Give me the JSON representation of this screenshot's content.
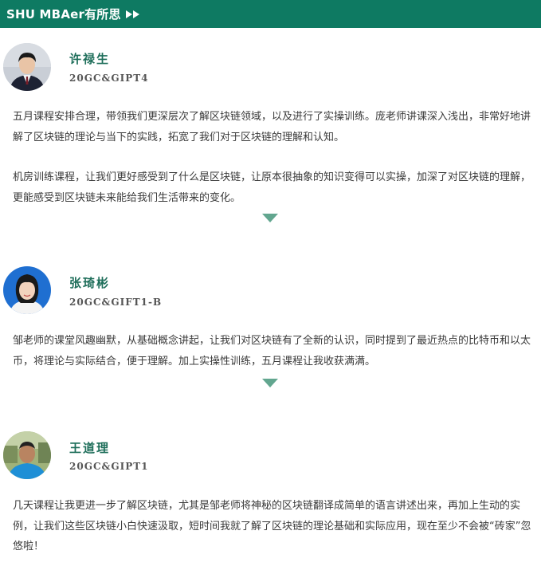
{
  "header": {
    "title": "SHU MBAer有所思",
    "arrow_icon": "double-play-icon",
    "background": "#0e7a62"
  },
  "profiles": [
    {
      "name": "许禄生",
      "class": "20GC&GIPT4",
      "avatar": "avatar-man-suit-photo",
      "paragraphs": [
        "五月课程安排合理，带领我们更深层次了解区块链领域，以及进行了实操训练。庞老师讲课深入浅出，非常好地讲解了区块链的理论与当下的实践，拓宽了我们对于区块链的理解和认知。",
        "机房训练课程，让我们更好感受到了什么是区块链，让原本很抽象的知识变得可以实操，加深了对区块链的理解，更能感受到区块链未来能给我们生活带来的变化。"
      ]
    },
    {
      "name": "张琦彬",
      "class": "20GC&GIFT1-B",
      "avatar": "avatar-woman-blue-background-photo",
      "paragraphs": [
        "邹老师的课堂风趣幽默，从基础概念讲起，让我们对区块链有了全新的认识，同时提到了最近热点的比特币和以太币，将理论与实际结合，便于理解。加上实操性训练，五月课程让我收获满满。"
      ]
    },
    {
      "name": "王道理",
      "class": "20GC&GIPT1",
      "avatar": "avatar-man-blue-shirt-photo",
      "paragraphs": [
        "几天课程让我更进一步了解区块链，尤其是邹老师将神秘的区块链翻译成简单的语言讲述出来，再加上生动的实例，让我们这些区块链小白快速汲取，短时间我就了解了区块链的理论基础和实际应用，现在至少不会被“砖家”忽悠啦！"
      ]
    }
  ],
  "divider_icon": "triangle-down-icon",
  "colors": {
    "accent": "#0e7a62",
    "name": "#1e6e5a",
    "divider": "#62a68f",
    "body_text": "#3a3a3a"
  }
}
